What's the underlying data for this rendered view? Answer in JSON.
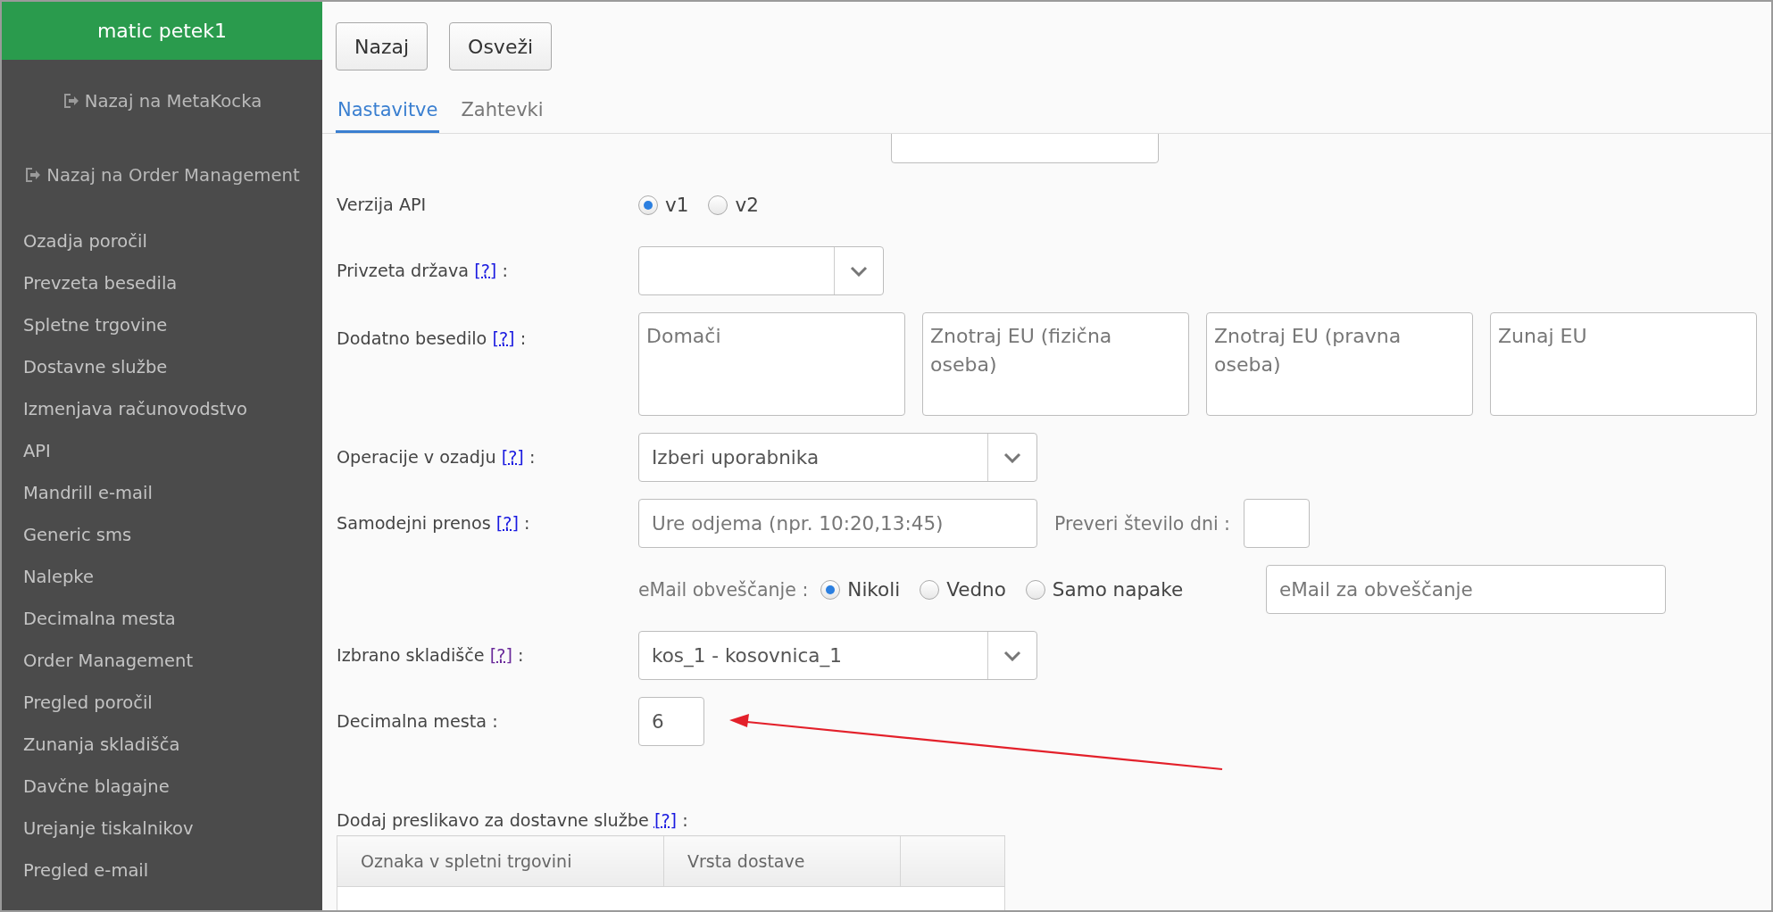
{
  "sidebar": {
    "user": "matic petek1",
    "links": [
      {
        "label": "Nazaj na MetaKocka"
      },
      {
        "label": "Nazaj na Order Management"
      }
    ],
    "items": [
      {
        "label": "Ozadja poročil"
      },
      {
        "label": "Prevzeta besedila"
      },
      {
        "label": "Spletne trgovine"
      },
      {
        "label": "Dostavne službe"
      },
      {
        "label": "Izmenjava računovodstvo"
      },
      {
        "label": "API"
      },
      {
        "label": "Mandrill e-mail"
      },
      {
        "label": "Generic sms"
      },
      {
        "label": "Nalepke"
      },
      {
        "label": "Decimalna mesta"
      },
      {
        "label": "Order Management"
      },
      {
        "label": "Pregled poročil"
      },
      {
        "label": "Zunanja skladišča"
      },
      {
        "label": "Davčne blagajne"
      },
      {
        "label": "Urejanje tiskalnikov"
      },
      {
        "label": "Pregled e-mail"
      }
    ]
  },
  "toolbar": {
    "buttons": [
      "Nazaj",
      "Osveži"
    ]
  },
  "tabs": [
    {
      "label": "Nastavitve",
      "selected": true
    },
    {
      "label": "Zahtevki",
      "selected": false
    }
  ],
  "form": {
    "rows": [
      {
        "kind": "partial"
      },
      {
        "kind": "radio",
        "label": "Verzija API",
        "options": [
          {
            "label": "v1",
            "selected": true
          },
          {
            "label": "v2",
            "selected": false
          }
        ]
      },
      {
        "kind": "select",
        "label": "Privzeta država",
        "help": {
          "text": "[?]",
          "visited": false
        },
        "suffix": ":"
      },
      {
        "kind": "textareas",
        "label": "Dodatno besedilo",
        "help": {
          "text": "[?]",
          "visited": false
        },
        "suffix": ":",
        "fields": [
          {
            "placeholder": "Domači"
          },
          {
            "placeholder": "Znotraj EU (fizična oseba)"
          },
          {
            "placeholder": "Znotraj EU (pravna oseba)"
          },
          {
            "placeholder": "Zunaj EU"
          }
        ]
      },
      {
        "kind": "select",
        "label": "Operacije v ozadju",
        "help": {
          "text": "[?]",
          "visited": false
        },
        "suffix": ":",
        "value": "Izberi uporabnika"
      },
      {
        "kind": "transfer",
        "label": "Samodejni prenos",
        "help": {
          "text": "[?]",
          "visited": false
        },
        "suffix": ":",
        "field": {
          "placeholder": "Ure odjema (npr. 10:20,13:45)"
        },
        "days_label": "Preveri število dni :"
      },
      {
        "kind": "notify",
        "label": "eMail obveščanje :",
        "options": [
          {
            "label": "Nikoli",
            "selected": true
          },
          {
            "label": "Vedno",
            "selected": false
          },
          {
            "label": "Samo napake",
            "selected": false
          }
        ],
        "field": {
          "placeholder": "eMail za obveščanje"
        }
      },
      {
        "kind": "select",
        "label": "Izbrano skladišče",
        "help": {
          "text": "[?]",
          "visited": true
        },
        "suffix": ":",
        "value": "kos_1 - kosovnica_1"
      },
      {
        "kind": "input",
        "label": "Decimalna mesta :",
        "value": "6"
      }
    ]
  },
  "mapping": {
    "title": "Dodaj preslikavo za dostavne službe",
    "help": {
      "text": "[?]",
      "visited": false
    },
    "suffix": ":",
    "columns": [
      "Oznaka v spletni trgovini",
      "Vrsta dostave"
    ]
  }
}
